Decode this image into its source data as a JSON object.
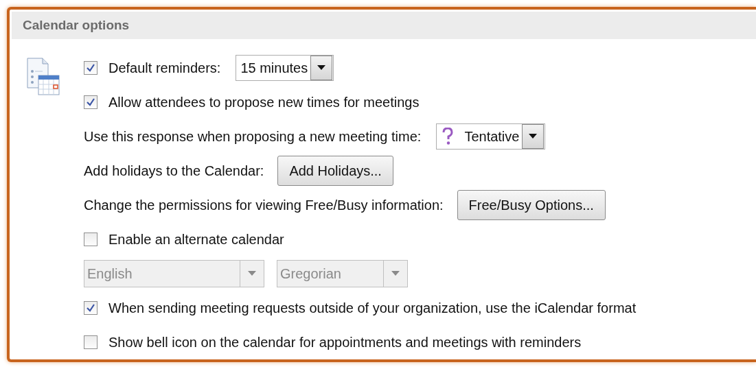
{
  "section": {
    "title": "Calendar options"
  },
  "rows": [
    {
      "kind": "checkbox",
      "checked": true,
      "label": "Default reminders:",
      "dropdown": {
        "value": "15 minutes"
      }
    },
    {
      "kind": "checkbox",
      "checked": true,
      "label": "Allow attendees to propose new times for meetings"
    },
    {
      "kind": "text",
      "label": "Use this response when proposing a new meeting time:",
      "dropdown": {
        "value": "Tentative"
      }
    },
    {
      "kind": "text",
      "label": "Add holidays to the Calendar:",
      "button": "Add Holidays..."
    },
    {
      "kind": "text",
      "label": "Change the permissions for viewing Free/Busy information:",
      "button": "Free/Busy Options..."
    },
    {
      "kind": "checkbox",
      "checked": false,
      "label": "Enable an alternate calendar"
    },
    {
      "kind": "selects",
      "selects": [
        {
          "value": "English",
          "disabled": true
        },
        {
          "value": "Gregorian",
          "disabled": true
        }
      ]
    },
    {
      "kind": "checkbox",
      "checked": true,
      "label": "When sending meeting requests outside of your organization, use the iCalendar format"
    },
    {
      "kind": "checkbox",
      "checked": false,
      "label": "Show bell icon on the calendar for appointments and meetings with reminders"
    }
  ]
}
